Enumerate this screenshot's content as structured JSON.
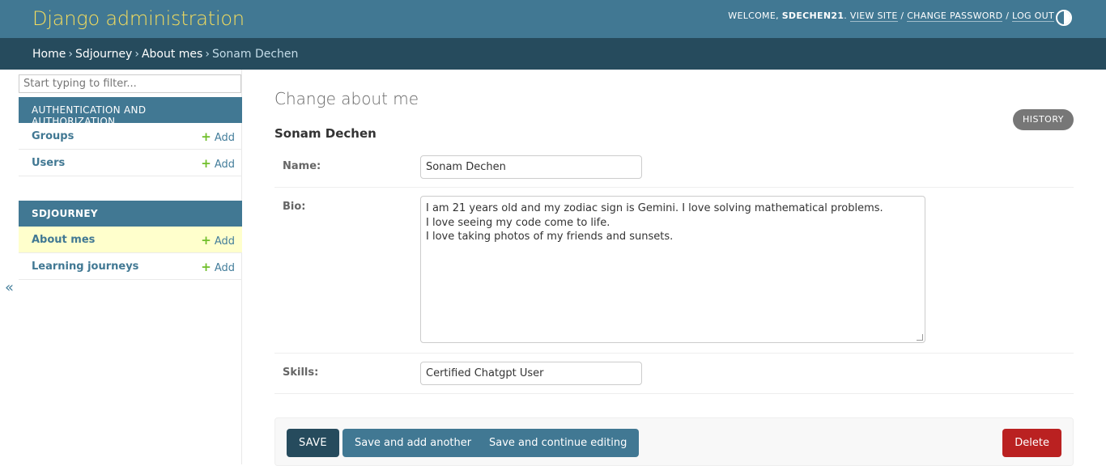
{
  "header": {
    "brand": "Django administration",
    "welcome": "WELCOME, ",
    "username": "SDECHEN21",
    "period": ". ",
    "view_site": "VIEW SITE",
    "slash1": " / ",
    "change_password": "CHANGE PASSWORD",
    "slash2": " / ",
    "log_out": "LOG OUT",
    "theme_icon": "theme-toggle-icon"
  },
  "breadcrumbs": {
    "home": "Home",
    "app": "Sdjourney",
    "model": "About mes",
    "current": "Sonam Dechen",
    "sep": "›"
  },
  "sidebar": {
    "filter_placeholder": "Start typing to filter...",
    "add_label": "Add",
    "collapse": "«",
    "modules": [
      {
        "caption": "AUTHENTICATION AND AUTHORIZATION",
        "items": [
          {
            "label": "Groups"
          },
          {
            "label": "Users"
          }
        ]
      },
      {
        "caption": "SDJOURNEY",
        "items": [
          {
            "label": "About mes",
            "current": true
          },
          {
            "label": "Learning journeys"
          }
        ]
      }
    ]
  },
  "main": {
    "title": "Change about me",
    "history": "HISTORY",
    "object_name": "Sonam Dechen",
    "fields": {
      "name_label": "Name:",
      "name_value": "Sonam Dechen",
      "bio_label": "Bio:",
      "bio_value": "I am 21 years old and my zodiac sign is Gemini. I love solving mathematical problems.\nI love seeing my code come to life.\nI love taking photos of my friends and sunsets.",
      "skills_label": "Skills:",
      "skills_value": "Certified Chatgpt User"
    },
    "buttons": {
      "save": "SAVE",
      "save_add_another": "Save and add another",
      "save_continue": "Save and continue editing",
      "delete": "Delete"
    }
  },
  "colors": {
    "header": "#417893",
    "breadcrumb": "#264b5d",
    "brand": "#f5dd5d",
    "delete": "#ba2121",
    "add_plus": "#70bf2b"
  }
}
